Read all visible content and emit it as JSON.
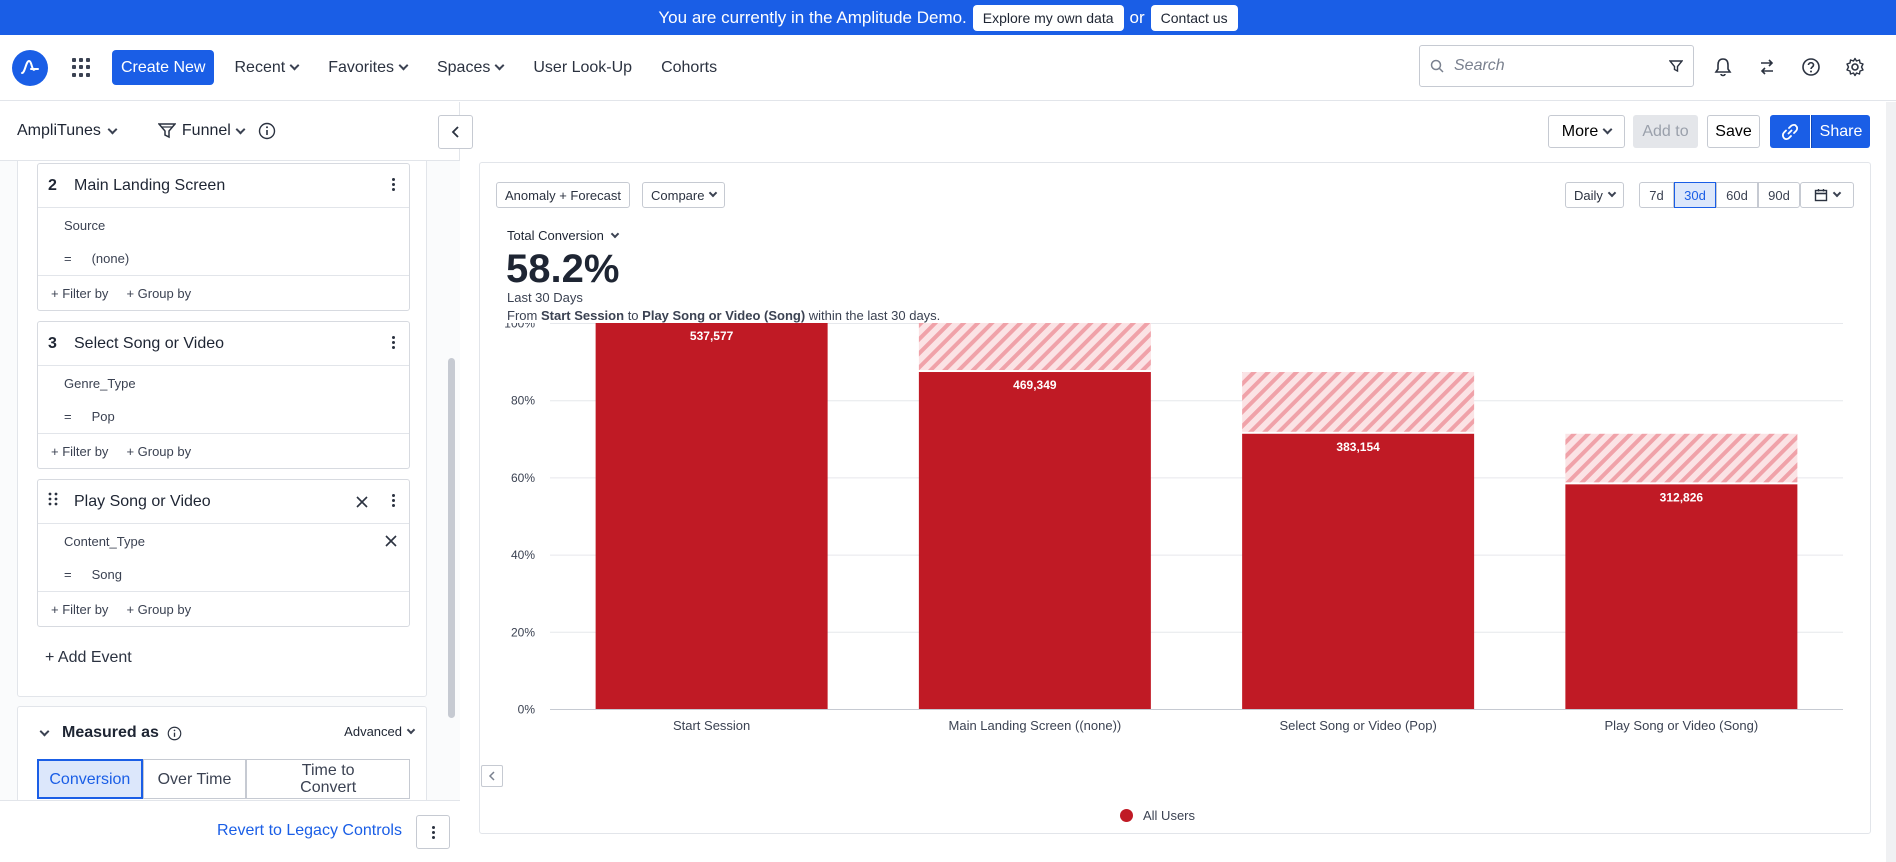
{
  "banner": {
    "message": "You are currently in the Amplitude Demo.",
    "explore_label": "Explore my own data",
    "or_text": "or",
    "contact_label": "Contact us"
  },
  "nav": {
    "create_label": "Create New",
    "items": [
      {
        "label": "Recent",
        "dropdown": true
      },
      {
        "label": "Favorites",
        "dropdown": true
      },
      {
        "label": "Spaces",
        "dropdown": true
      },
      {
        "label": "User Look-Up",
        "dropdown": false
      },
      {
        "label": "Cohorts",
        "dropdown": false
      }
    ],
    "search_placeholder": "Search",
    "icons": [
      "bell-icon",
      "switch-icon",
      "help-icon",
      "gear-icon"
    ]
  },
  "left": {
    "project": "AmpliTunes",
    "chart_type": "Funnel",
    "steps": [
      {
        "number": "2",
        "name": "Main Landing Screen",
        "property": "Source",
        "operator": "=",
        "value": "(none)",
        "removable": false
      },
      {
        "number": "3",
        "name": "Select Song or Video",
        "property": "Genre_Type",
        "operator": "=",
        "value": "Pop",
        "removable": false
      },
      {
        "number": "",
        "name": "Play Song or Video",
        "property": "Content_Type",
        "operator": "=",
        "value": "Song",
        "removable": true
      }
    ],
    "filter_label": "+ Filter by",
    "group_label": "+ Group by",
    "add_event_label": "+ Add Event",
    "measured_as": "Measured as",
    "advanced_label": "Advanced",
    "measure_tabs": [
      "Conversion",
      "Over Time",
      "Time to Convert"
    ],
    "active_measure": "Conversion",
    "revert_label": "Revert to Legacy Controls"
  },
  "toolbar": {
    "more_label": "More",
    "addto_label": "Add to",
    "save_label": "Save",
    "share_label": "Share"
  },
  "chart_controls": {
    "anomaly_label": "Anomaly + Forecast",
    "compare_label": "Compare",
    "interval_label": "Daily",
    "ranges": [
      "7d",
      "30d",
      "60d",
      "90d"
    ],
    "active_range": "30d"
  },
  "summary": {
    "metric_label": "Total Conversion",
    "value": "58.2%",
    "period": "Last 30 Days",
    "from_text": "From",
    "from_event": "Start Session",
    "to_text": "to",
    "to_event": "Play Song or Video (Song)",
    "suffix": "within the last 30 days."
  },
  "chart_data": {
    "type": "bar",
    "categories": [
      "Start Session",
      "Main Landing Screen ((none))",
      "Select Song or Video (Pop)",
      "Play Song or Video (Song)"
    ],
    "series": [
      {
        "name": "All Users",
        "values": [
          100,
          87.3,
          71.3,
          58.2
        ],
        "labels": [
          "537,577",
          "469,349",
          "383,154",
          "312,826"
        ]
      }
    ],
    "dropoff_top": [
      100,
      100,
      87.3,
      71.3
    ],
    "yticks": [
      "0%",
      "20%",
      "40%",
      "60%",
      "80%",
      "100%"
    ],
    "ylim": [
      0,
      100
    ],
    "legend": "bottom",
    "grid": true,
    "bar_color": "#c01a25",
    "dropoff_color": "#f3a6ac"
  }
}
